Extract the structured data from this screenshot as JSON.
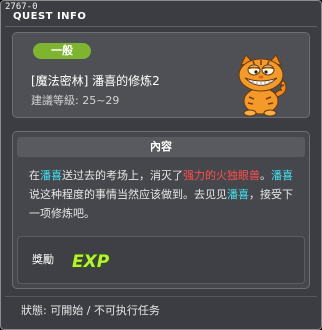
{
  "window": {
    "id_label": "2767-0",
    "title": "QUEST INFO"
  },
  "quest": {
    "category_badge": "一般",
    "name": "[魔法密林] 潘喜的修炼2",
    "level_range": "建議等級: 25~29",
    "npc_icon": "garfield-cat-icon"
  },
  "content": {
    "header": "內容",
    "segments": {
      "s1": "在",
      "s2": "潘喜",
      "s3": "送过去的考场上，消灭了",
      "s4": "强力的火独眼兽",
      "s5": "。",
      "s6": "潘喜",
      "s7": "说这种程度的事情当然应该做到。去见见",
      "s8": "潘喜",
      "s9": "，接受下一项修炼吧。"
    }
  },
  "reward": {
    "label": "獎勵",
    "icon": "exp-icon",
    "icon_text": "EXP"
  },
  "footer": {
    "status": "狀態: 可開始 / 不可执行任务"
  },
  "colors": {
    "window_bg": "#3b3d42",
    "panel_bg": "#4e5055",
    "badge_green": "#7fb431",
    "highlight_cyan": "#45e0f0",
    "highlight_red": "#ff4d4d"
  }
}
